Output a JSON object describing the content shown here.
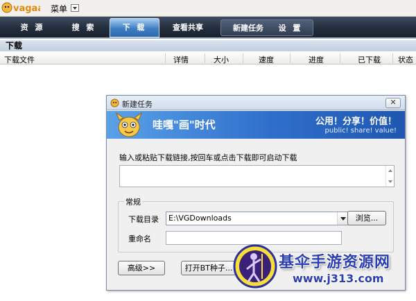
{
  "app": {
    "logo_text": "vagaa",
    "menu_label": "菜单"
  },
  "nav": {
    "tabs": [
      {
        "label": "资 源",
        "active": false
      },
      {
        "label": "搜 索",
        "active": false
      },
      {
        "label": "下 载",
        "active": true
      },
      {
        "label": "查看共享",
        "active": false
      }
    ],
    "group": [
      "新建任务",
      "设 置"
    ]
  },
  "section": {
    "title": "下载"
  },
  "table": {
    "columns": [
      "下载文件",
      "详情",
      "大小",
      "速度",
      "进度",
      "已下载",
      "状态"
    ]
  },
  "dialog": {
    "title": "新建任务",
    "close_label": "✕",
    "banner": {
      "slogan": "哇嘎\"画\"时代",
      "right_cn": "公用！分享！价值！",
      "right_en": "public! share! value!"
    },
    "instruction": "输入或粘贴下载链接,按回车或点击下载即可启动下载",
    "link_value": "",
    "group_title": "常规",
    "dir_label": "下载目录",
    "dir_value": "E:\\VGDownloads",
    "browse_label": "浏览...",
    "rename_label": "重命名",
    "rename_value": "",
    "advanced_label": "高级>>",
    "open_bt_label": "打开BT种子..."
  },
  "watermark": {
    "title": "基伞手游资源网",
    "url": "www.j313.com"
  },
  "colors": {
    "nav_bg": "#222b3a",
    "tab_active": "#3f7ec0",
    "banner": "#2f6fcb",
    "watermark": "#2b3fb0"
  }
}
